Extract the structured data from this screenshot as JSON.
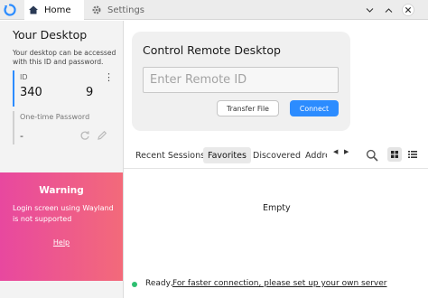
{
  "titlebar": {
    "tabs": [
      {
        "label": "Home",
        "icon": "home-icon"
      },
      {
        "label": "Settings",
        "icon": "gear-icon"
      }
    ],
    "controls": [
      "minimize-icon",
      "maximize-icon",
      "close-icon"
    ]
  },
  "left": {
    "title": "Your Desktop",
    "description": "Your desktop can be accessed with this ID and password.",
    "id_label": "ID",
    "id_part1": "340",
    "id_part2": "9",
    "otp_label": "One-time Password",
    "otp_value": "-"
  },
  "warning": {
    "title": "Warning",
    "text": "Login screen using Wayland is not supported",
    "help": "Help"
  },
  "control": {
    "title": "Control Remote Desktop",
    "placeholder": "Enter Remote ID",
    "transfer_label": "Transfer File",
    "connect_label": "Connect"
  },
  "sessions": {
    "tabs": [
      "Recent Sessions",
      "Favorites",
      "Discovered",
      "Addre"
    ],
    "active_tab": "Favorites",
    "empty_text": "Empty"
  },
  "status": {
    "ready": "Ready,",
    "link": "For faster connection, please set up your own server"
  },
  "colors": {
    "accent": "#2c8cff",
    "warning_start": "#e8489f",
    "warning_end": "#f36a7a",
    "status_ok": "#2fbf71"
  }
}
